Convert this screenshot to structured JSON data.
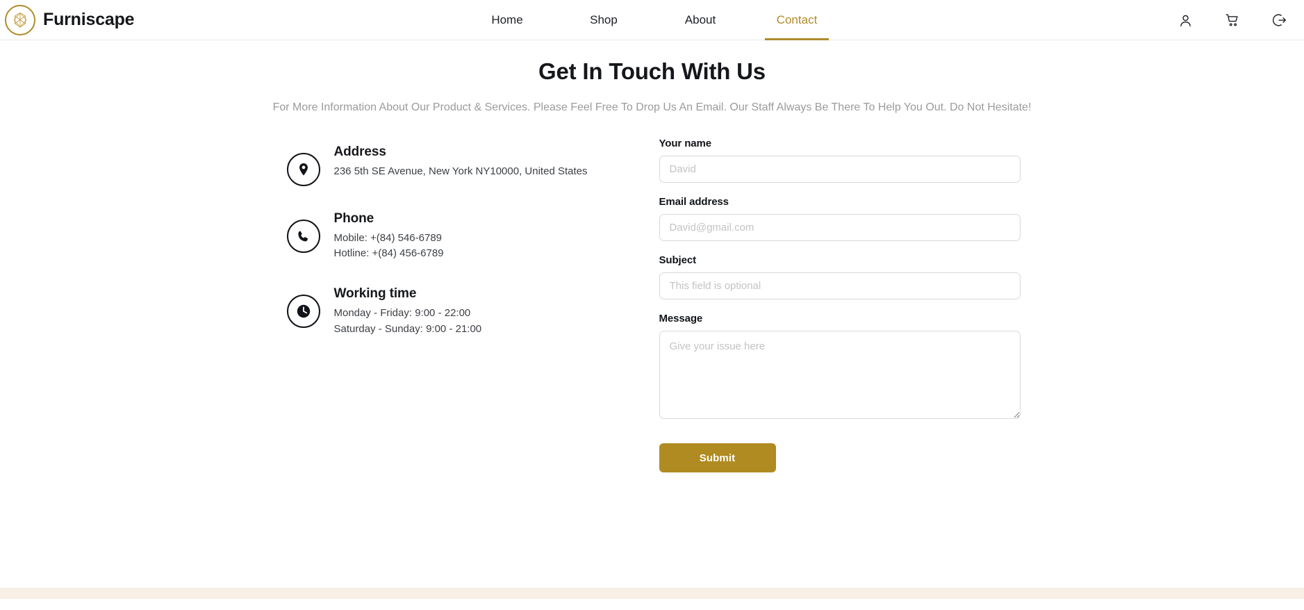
{
  "header": {
    "brand": {
      "name": "Furniscape",
      "logo_icon": "gem-polyhedron-logo-icon",
      "logo_color": "#b08b2b"
    },
    "nav": [
      {
        "label": "Home",
        "active": false
      },
      {
        "label": "Shop",
        "active": false
      },
      {
        "label": "About",
        "active": false
      },
      {
        "label": "Contact",
        "active": true
      }
    ],
    "actions": [
      {
        "name": "account-icon",
        "title": "Account"
      },
      {
        "name": "cart-icon",
        "title": "Cart"
      },
      {
        "name": "logout-icon",
        "title": "Log out"
      }
    ],
    "accent_color": "#b08b2b"
  },
  "main": {
    "title": "Get In Touch With Us",
    "subtitle": "For More Information About Our Product & Services. Please Feel Free To Drop Us An Email. Our Staff Always Be There To Help You Out. Do Not Hesitate!",
    "contact_info": [
      {
        "icon": "location-pin-icon",
        "title": "Address",
        "lines": [
          "236 5th SE Avenue, New York NY10000, United States"
        ]
      },
      {
        "icon": "phone-icon",
        "title": "Phone",
        "lines": [
          "Mobile: +(84) 546-6789",
          "Hotline: +(84) 456-6789"
        ]
      },
      {
        "icon": "clock-icon",
        "title": "Working time",
        "lines": [
          "Monday - Friday: 9:00 - 22:00",
          "Saturday - Sunday: 9:00 - 21:00"
        ]
      }
    ],
    "form": {
      "fields": [
        {
          "label": "Your name",
          "placeholder": "David",
          "value": "",
          "type": "text"
        },
        {
          "label": "Email address",
          "placeholder": "David@gmail.com",
          "value": "",
          "type": "email"
        },
        {
          "label": "Subject",
          "placeholder": "This field is optional",
          "value": "",
          "type": "text"
        },
        {
          "label": "Message",
          "placeholder": "Give your issue here",
          "value": "",
          "type": "textarea"
        }
      ],
      "submit_label": "Submit",
      "submit_color": "#b08b21"
    }
  },
  "footer": {
    "strip_color": "#f8efe7"
  }
}
